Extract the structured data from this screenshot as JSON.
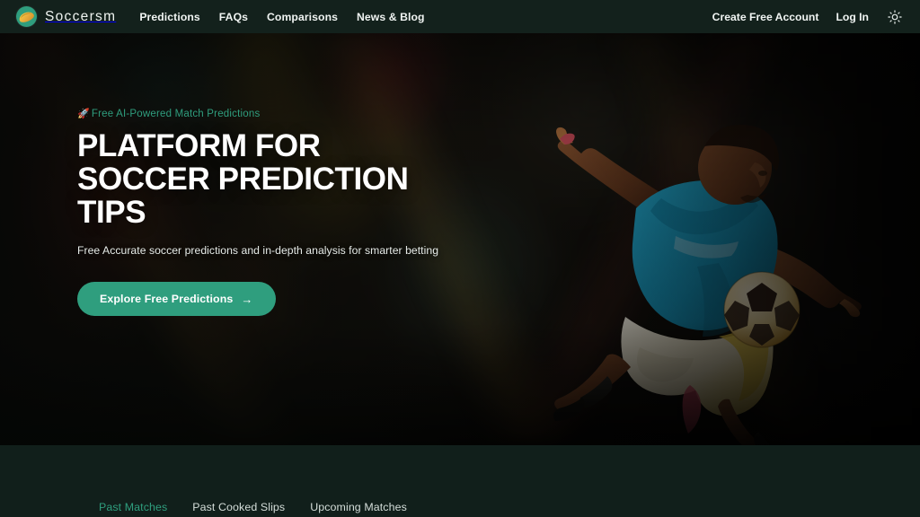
{
  "brand": {
    "name": "Soccersm",
    "logo_icon": "soccer-ball-logo-icon"
  },
  "nav": {
    "links": [
      {
        "label": "Predictions"
      },
      {
        "label": "FAQs"
      },
      {
        "label": "Comparisons"
      },
      {
        "label": "News & Blog"
      }
    ],
    "create_account_label": "Create Free Account",
    "login_label": "Log In",
    "theme_toggle_icon": "sun-icon"
  },
  "hero": {
    "eyebrow_emoji": "🚀",
    "eyebrow": "Free AI-Powered Match Predictions",
    "title": "PLATFORM FOR SOCCER PREDICTION TIPS",
    "subtitle": "Free Accurate soccer predictions and in-depth analysis for smarter betting",
    "cta_label": "Explore Free Predictions",
    "cta_arrow": "→",
    "image_alt": "soccer-player-kicking-ball"
  },
  "tabs": [
    {
      "label": "Past Matches",
      "active": true
    },
    {
      "label": "Past Cooked Slips",
      "active": false
    },
    {
      "label": "Upcoming Matches",
      "active": false
    }
  ],
  "colors": {
    "accent": "#2f9e7e",
    "navbar_bg": "#13211c",
    "lower_bg": "#111f1b",
    "text_light": "#f0f4f2",
    "jersey": "#1fa8d0"
  }
}
